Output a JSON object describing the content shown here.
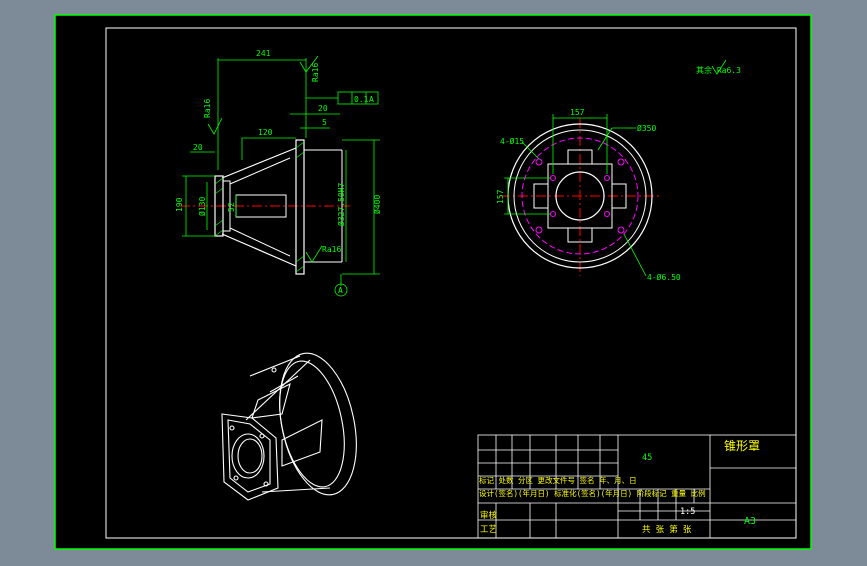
{
  "colors": {
    "background": "#7d8a97",
    "sheet": "#000000",
    "border": "#00ff00",
    "dimension": "#00ff00",
    "outline": "#ffffff",
    "centerline": "#ff0000",
    "hidden": "#ff00ff",
    "title_text": "#ffff00"
  },
  "front_view": {
    "dims": {
      "d241": "241",
      "d20a": "20",
      "d5": "5",
      "d120": "120",
      "d20b": "20",
      "d190": "190",
      "d130": "Ø130",
      "d52": "52",
      "d327": "Ø327.50H7",
      "d400": "Ø400"
    },
    "roughness": {
      "r1": "Ra16",
      "r2": "Ra16",
      "r3": "Ra16"
    },
    "tolerance": {
      "value": "0.1",
      "datum": "A"
    },
    "datum_label": "A"
  },
  "side_view": {
    "d157a": "157",
    "d157b": "157",
    "d350": "Ø350",
    "holes_top": "4-Ø15",
    "holes_bottom": "4-Ø6.50"
  },
  "general_roughness": "其余 Ra6.3",
  "title_block": {
    "part_name": "锥形罩",
    "quantity": "45",
    "scale": "1:5",
    "sheet_size": "A3",
    "row1": "标记 处数 分区 更改文件号 签名 年、月、日",
    "row2": "设计(签名)(年月日) 标准化(签名)(年月日) 阶段标记 重量 比例",
    "reviewer": "审核",
    "process": "工艺",
    "sheets": "共 张 第 张"
  }
}
